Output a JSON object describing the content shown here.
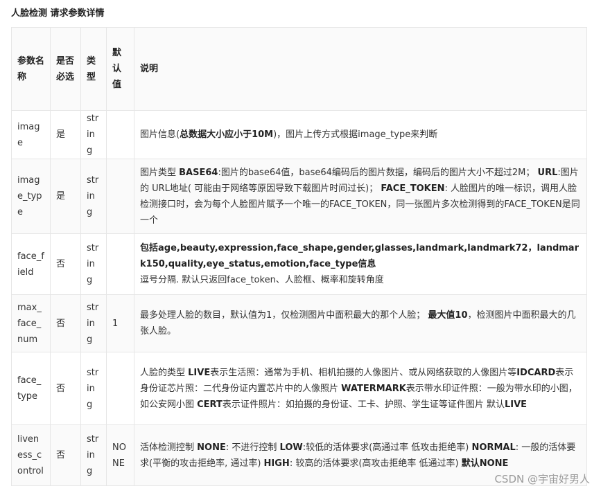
{
  "title": "人脸检测 请求参数详情",
  "table": {
    "headers": [
      "参数名称",
      "是否必选",
      "类型",
      "默认值",
      "说明"
    ],
    "rows": [
      {
        "name": "image",
        "required": "是",
        "type": "string",
        "default": "",
        "desc": [
          {
            "t": "图片信息(",
            "b": false
          },
          {
            "t": "总数据大小应小于10M",
            "b": true
          },
          {
            "t": ")，图片上传方式根据image_type来判断",
            "b": false
          }
        ]
      },
      {
        "name": "image_type",
        "required": "是",
        "type": "string",
        "default": "",
        "desc": [
          {
            "t": "图片类型 ",
            "b": false
          },
          {
            "t": "BASE64",
            "b": true
          },
          {
            "t": ":图片的base64值，base64编码后的图片数据，编码后的图片大小不超过2M； ",
            "b": false
          },
          {
            "t": "URL",
            "b": true
          },
          {
            "t": ":图片的 URL地址( 可能由于网络等原因导致下载图片时间过长)； ",
            "b": false
          },
          {
            "t": "FACE_TOKEN",
            "b": true
          },
          {
            "t": ": 人脸图片的唯一标识，调用人脸检测接口时，会为每个人脸图片赋予一个唯一的FACE_TOKEN，同一张图片多次检测得到的FACE_TOKEN是同一个",
            "b": false
          }
        ]
      },
      {
        "name": "face_field",
        "required": "否",
        "type": "string",
        "default": "",
        "desc": [
          {
            "t": "包括age,beauty,expression,face_shape,gender,glasses,landmark,landmark72，landmark150,quality,eye_status,emotion,face_type信息",
            "b": true
          },
          {
            "t": "逗号分隔. 默认只返回face_token、人脸框、概率和旋转角度",
            "b": false,
            "br": true
          }
        ]
      },
      {
        "name": "max_face_num",
        "required": "否",
        "type": "string",
        "default": "1",
        "desc": [
          {
            "t": "最多处理人脸的数目，默认值为1，仅检测图片中面积最大的那个人脸； ",
            "b": false
          },
          {
            "t": "最大值10",
            "b": true
          },
          {
            "t": "，检测图片中面积最大的几张人脸。",
            "b": false
          }
        ]
      },
      {
        "name": "face_type",
        "required": "否",
        "type": "string",
        "default": "",
        "desc": [
          {
            "t": "人脸的类型 ",
            "b": false
          },
          {
            "t": "LIVE",
            "b": true
          },
          {
            "t": "表示生活照：通常为手机、相机拍摄的人像图片、或从网络获取的人像图片等",
            "b": false
          },
          {
            "t": "IDCARD",
            "b": true
          },
          {
            "t": "表示身份证芯片照：二代身份证内置芯片中的人像照片 ",
            "b": false
          },
          {
            "t": "WATERMARK",
            "b": true
          },
          {
            "t": "表示带水印证件照：一般为带水印的小图，如公安网小图 ",
            "b": false
          },
          {
            "t": "CERT",
            "b": true
          },
          {
            "t": "表示证件照片：如拍摄的身份证、工卡、护照、学生证等证件图片 默认",
            "b": false
          },
          {
            "t": "LIVE",
            "b": true
          }
        ]
      },
      {
        "name": "liveness_control",
        "required": "否",
        "type": "string",
        "default": "NONE",
        "desc": [
          {
            "t": "活体检测控制 ",
            "b": false
          },
          {
            "t": "NONE",
            "b": true
          },
          {
            "t": ": 不进行控制 ",
            "b": false
          },
          {
            "t": "LOW",
            "b": true
          },
          {
            "t": ":较低的活体要求(高通过率 低攻击拒绝率) ",
            "b": false
          },
          {
            "t": "NORMAL",
            "b": true
          },
          {
            "t": ": 一般的活体要求(平衡的攻击拒绝率, 通过率) ",
            "b": false
          },
          {
            "t": "HIGH",
            "b": true
          },
          {
            "t": ": 较高的活体要求(高攻击拒绝率 低通过率) ",
            "b": false
          },
          {
            "t": "默认NONE",
            "b": true
          }
        ]
      }
    ]
  },
  "watermark": "CSDN @宇宙好男人"
}
